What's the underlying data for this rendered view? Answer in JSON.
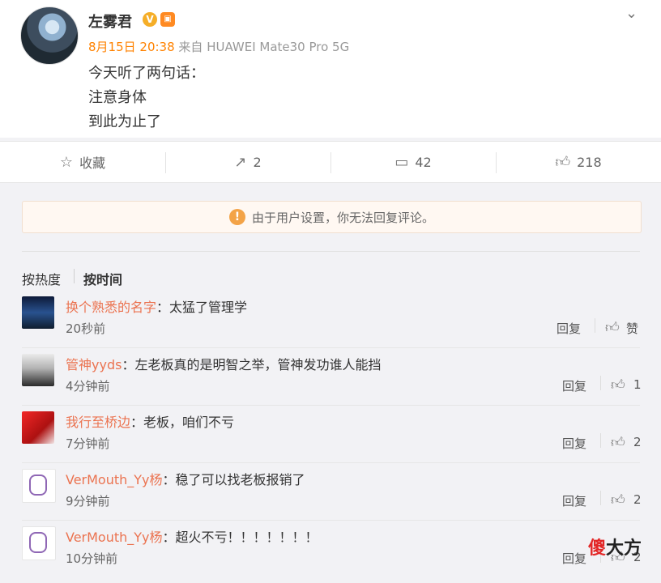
{
  "post": {
    "username": "左雾君",
    "timestamp": "8月15日 20:38",
    "source": "来自 HUAWEI Mate30 Pro 5G",
    "content": [
      "今天听了两句话：",
      "注意身体",
      "到此为止了"
    ],
    "badge_v_text": "V",
    "more_icon": "chevron-down-icon"
  },
  "actions": {
    "favorite_label": "收藏",
    "repost_count": "2",
    "comment_count": "42",
    "like_count": "218"
  },
  "notice": {
    "text": "由于用户设置，你无法回复评论。",
    "warn_icon": "!"
  },
  "sort": {
    "hot_label": "按热度",
    "time_label": "按时间"
  },
  "comments": [
    {
      "user": "换个熟悉的名字",
      "text": "：太猛了管理学",
      "time": "20秒前",
      "reply": "回复",
      "like": "赞"
    },
    {
      "user": "管神yyds",
      "text": "：左老板真的是明智之举，管神发功谁人能挡",
      "time": "4分钟前",
      "reply": "回复",
      "like": "1"
    },
    {
      "user": "我行至桥边",
      "text": "：老板，咱们不亏",
      "time": "7分钟前",
      "reply": "回复",
      "like": "2"
    },
    {
      "user": "VerMouth_Yy杨",
      "text": "：稳了可以找老板报销了",
      "time": "9分钟前",
      "reply": "回复",
      "like": "2"
    },
    {
      "user": "VerMouth_Yy杨",
      "text": "：超火不亏！！！！！！！",
      "time": "10分钟前",
      "reply": "回复",
      "like": "2"
    }
  ],
  "watermark": {
    "red": "傻",
    "black": "大方"
  }
}
